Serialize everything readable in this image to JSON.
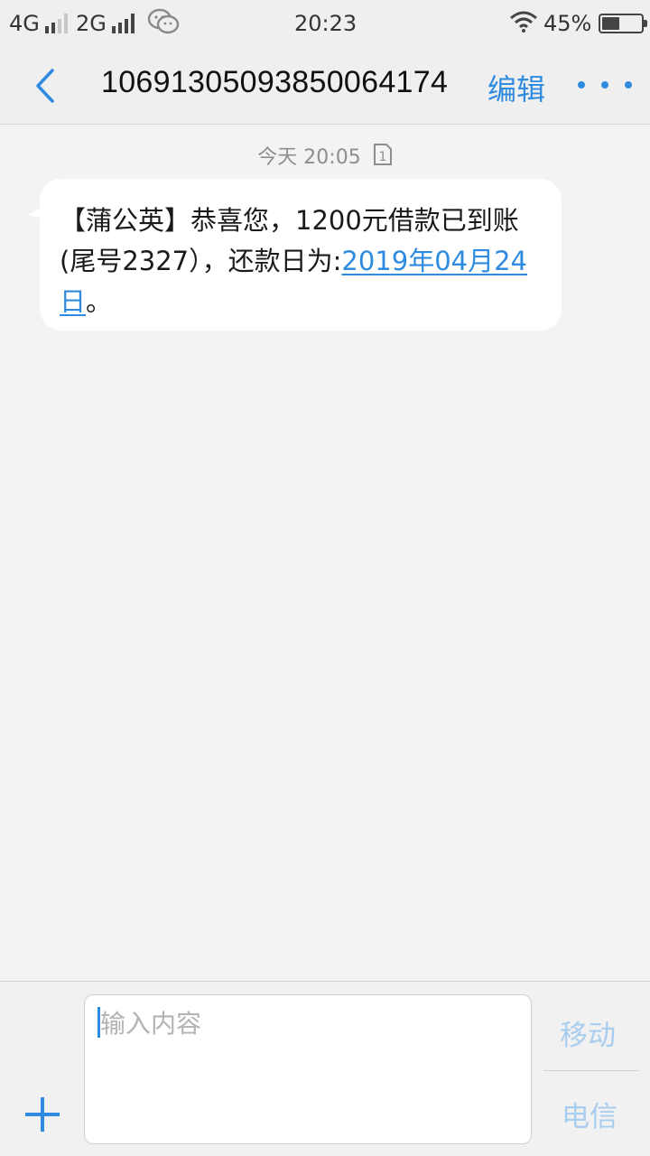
{
  "status_bar": {
    "network1": "4G",
    "network2": "2G",
    "time": "20:23",
    "battery": "45%",
    "battery_level": 0.45,
    "icons": [
      "signal-icon",
      "wechat-icon",
      "wifi-icon",
      "battery-icon"
    ]
  },
  "header": {
    "title": "1069130509385006​4174",
    "edit_label": "编辑",
    "back_icon": "chevron-left-icon",
    "more_icon": "more-dots-icon"
  },
  "conversation": {
    "timestamp": "今天 20:05",
    "sim_badge": "1",
    "message": {
      "text_before": "【蒲公英】恭喜您，1200元借款已到账(尾号2327），还款日为:",
      "link_text": "2019年04月24日",
      "text_after": "。"
    }
  },
  "composer": {
    "placeholder": "输入内容",
    "send_mobile_label": "移动",
    "send_telecom_label": "电信",
    "add_icon": "plus-icon"
  },
  "colors": {
    "accent": "#2f8be0",
    "send_disabled": "#a9cdef",
    "background": "#f3f3f3"
  }
}
